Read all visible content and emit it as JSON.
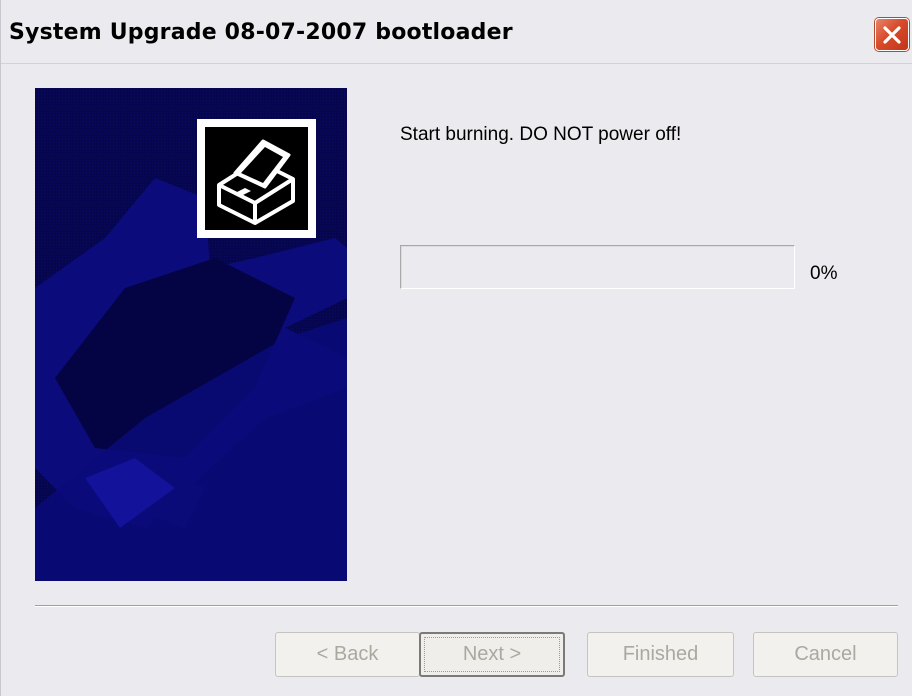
{
  "window": {
    "title": "System Upgrade 08-07-2007 bootloader",
    "close_icon": "close-icon"
  },
  "wizard": {
    "side_image": "printer-illustration",
    "icon": "printer-icon",
    "message": "Start burning. DO NOT power off!",
    "progress": {
      "value_fraction": 0,
      "label": "0%"
    }
  },
  "buttons": {
    "back": "< Back",
    "next": "Next >",
    "finished": "Finished",
    "cancel": "Cancel"
  },
  "colors": {
    "side_image_bg": "#04044a",
    "close_button": "#d84a2a",
    "dialog_bg": "#ebeaee",
    "disabled_text": "#aaa99f"
  }
}
